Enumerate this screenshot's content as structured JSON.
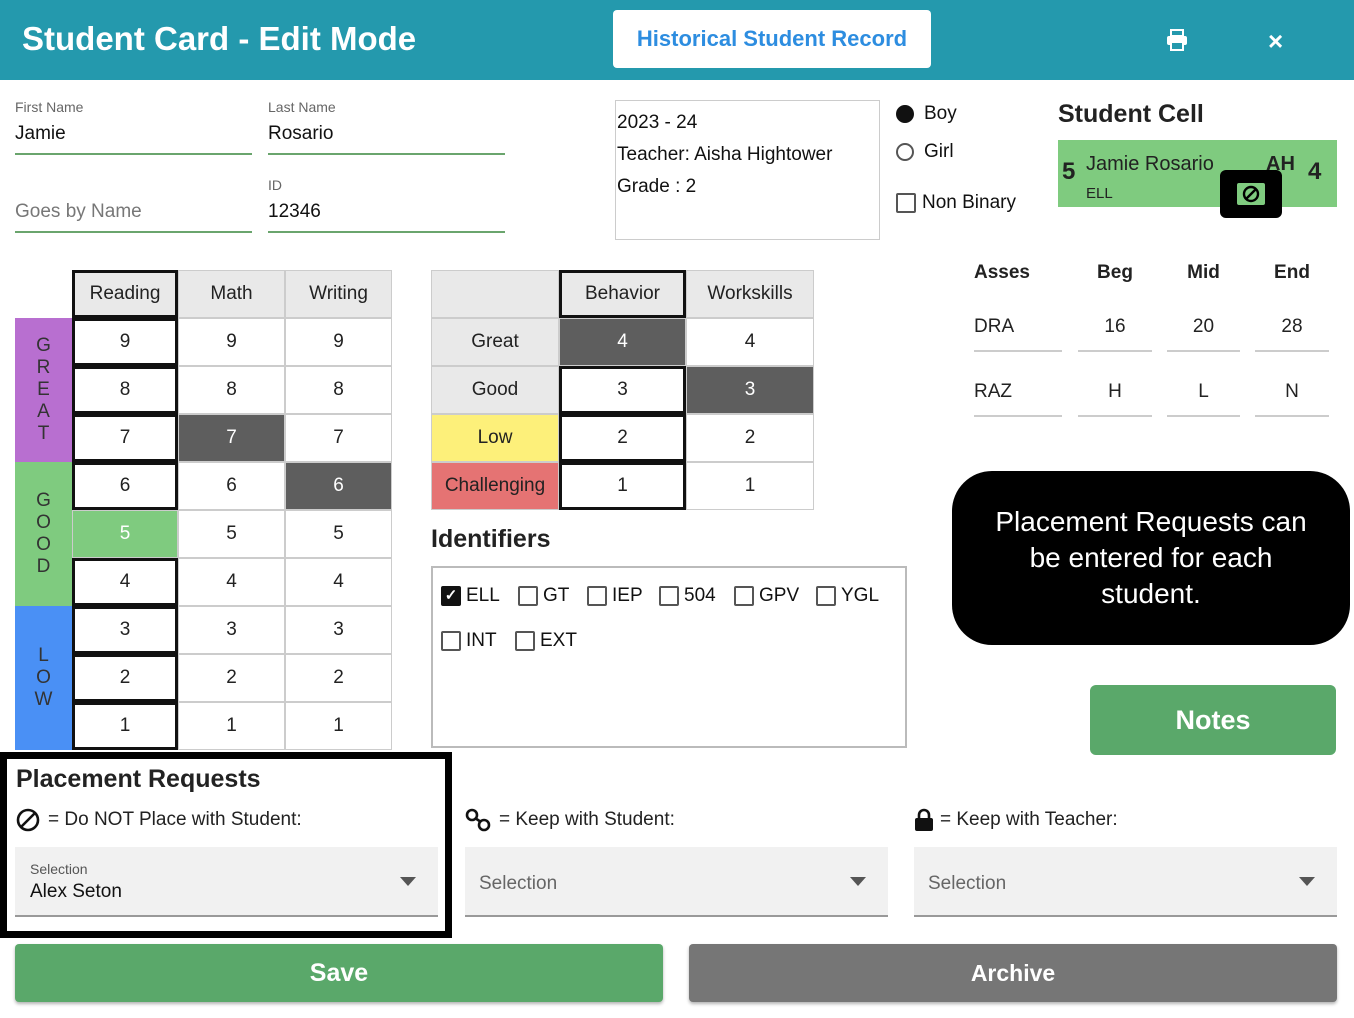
{
  "header": {
    "title": "Student Card - Edit Mode",
    "historical_button": "Historical Student Record",
    "close_glyph": "×"
  },
  "fields": {
    "first_name_label": "First Name",
    "first_name": "Jamie",
    "last_name_label": "Last Name",
    "last_name": "Rosario",
    "goes_by_placeholder": "Goes by Name",
    "id_label": "ID",
    "id": "12346"
  },
  "info": {
    "year": "2023 - 24",
    "teacher": "Teacher: Aisha Hightower",
    "grade": "Grade : 2"
  },
  "gender": {
    "boy": "Boy",
    "girl": "Girl",
    "non_binary": "Non Binary",
    "selected": "Boy"
  },
  "student_cell": {
    "title": "Student Cell",
    "left_num": "5",
    "name": "Jamie Rosario",
    "tag": "ELL",
    "initials": "AH",
    "right_num": "4",
    "color": "#7fcb7f"
  },
  "academics": {
    "columns": [
      "Reading",
      "Math",
      "Writing"
    ],
    "rows": [
      "9",
      "8",
      "7",
      "6",
      "5",
      "4",
      "3",
      "2",
      "1"
    ],
    "bands": [
      {
        "label": "GREAT",
        "color": "#b86fd0"
      },
      {
        "label": "GOOD",
        "color": "#7fcb7f"
      },
      {
        "label": "LOW",
        "color": "#4a90f5"
      }
    ],
    "selected": {
      "Reading": "5",
      "Math": "7",
      "Writing": "6"
    }
  },
  "behavior": {
    "columns": [
      "Behavior",
      "Workskills"
    ],
    "rows": [
      {
        "label": "Great",
        "value": "4",
        "color": "#e9e9e9"
      },
      {
        "label": "Good",
        "value": "3",
        "color": "#e9e9e9"
      },
      {
        "label": "Low",
        "value": "2",
        "color": "#fdf07a"
      },
      {
        "label": "Challenging",
        "value": "1",
        "color": "#e57373"
      }
    ],
    "selected": {
      "Behavior": "4",
      "Workskills": "3"
    }
  },
  "assessments": {
    "headers": [
      "Asses",
      "Beg",
      "Mid",
      "End"
    ],
    "rows": [
      [
        "DRA",
        "16",
        "20",
        "28"
      ],
      [
        "RAZ",
        "H",
        "L",
        "N"
      ]
    ]
  },
  "identifiers": {
    "title": "Identifiers",
    "items": [
      {
        "label": "ELL",
        "checked": true
      },
      {
        "label": "GT",
        "checked": false
      },
      {
        "label": "IEP",
        "checked": false
      },
      {
        "label": "504",
        "checked": false
      },
      {
        "label": "GPV",
        "checked": false
      },
      {
        "label": "YGL",
        "checked": false
      },
      {
        "label": "INT",
        "checked": false
      },
      {
        "label": "EXT",
        "checked": false
      }
    ]
  },
  "tooltip": {
    "text": "Placement Requests can be entered for each student."
  },
  "notes_button": "Notes",
  "placement": {
    "title": "Placement Requests",
    "do_not": {
      "label": "= Do NOT Place with Student:",
      "select_label": "Selection",
      "value": "Alex Seton"
    },
    "keep_student": {
      "label": "= Keep with Student:",
      "placeholder": "Selection"
    },
    "keep_teacher": {
      "label": "= Keep with Teacher:",
      "placeholder": "Selection"
    }
  },
  "actions": {
    "save": "Save",
    "archive": "Archive"
  }
}
